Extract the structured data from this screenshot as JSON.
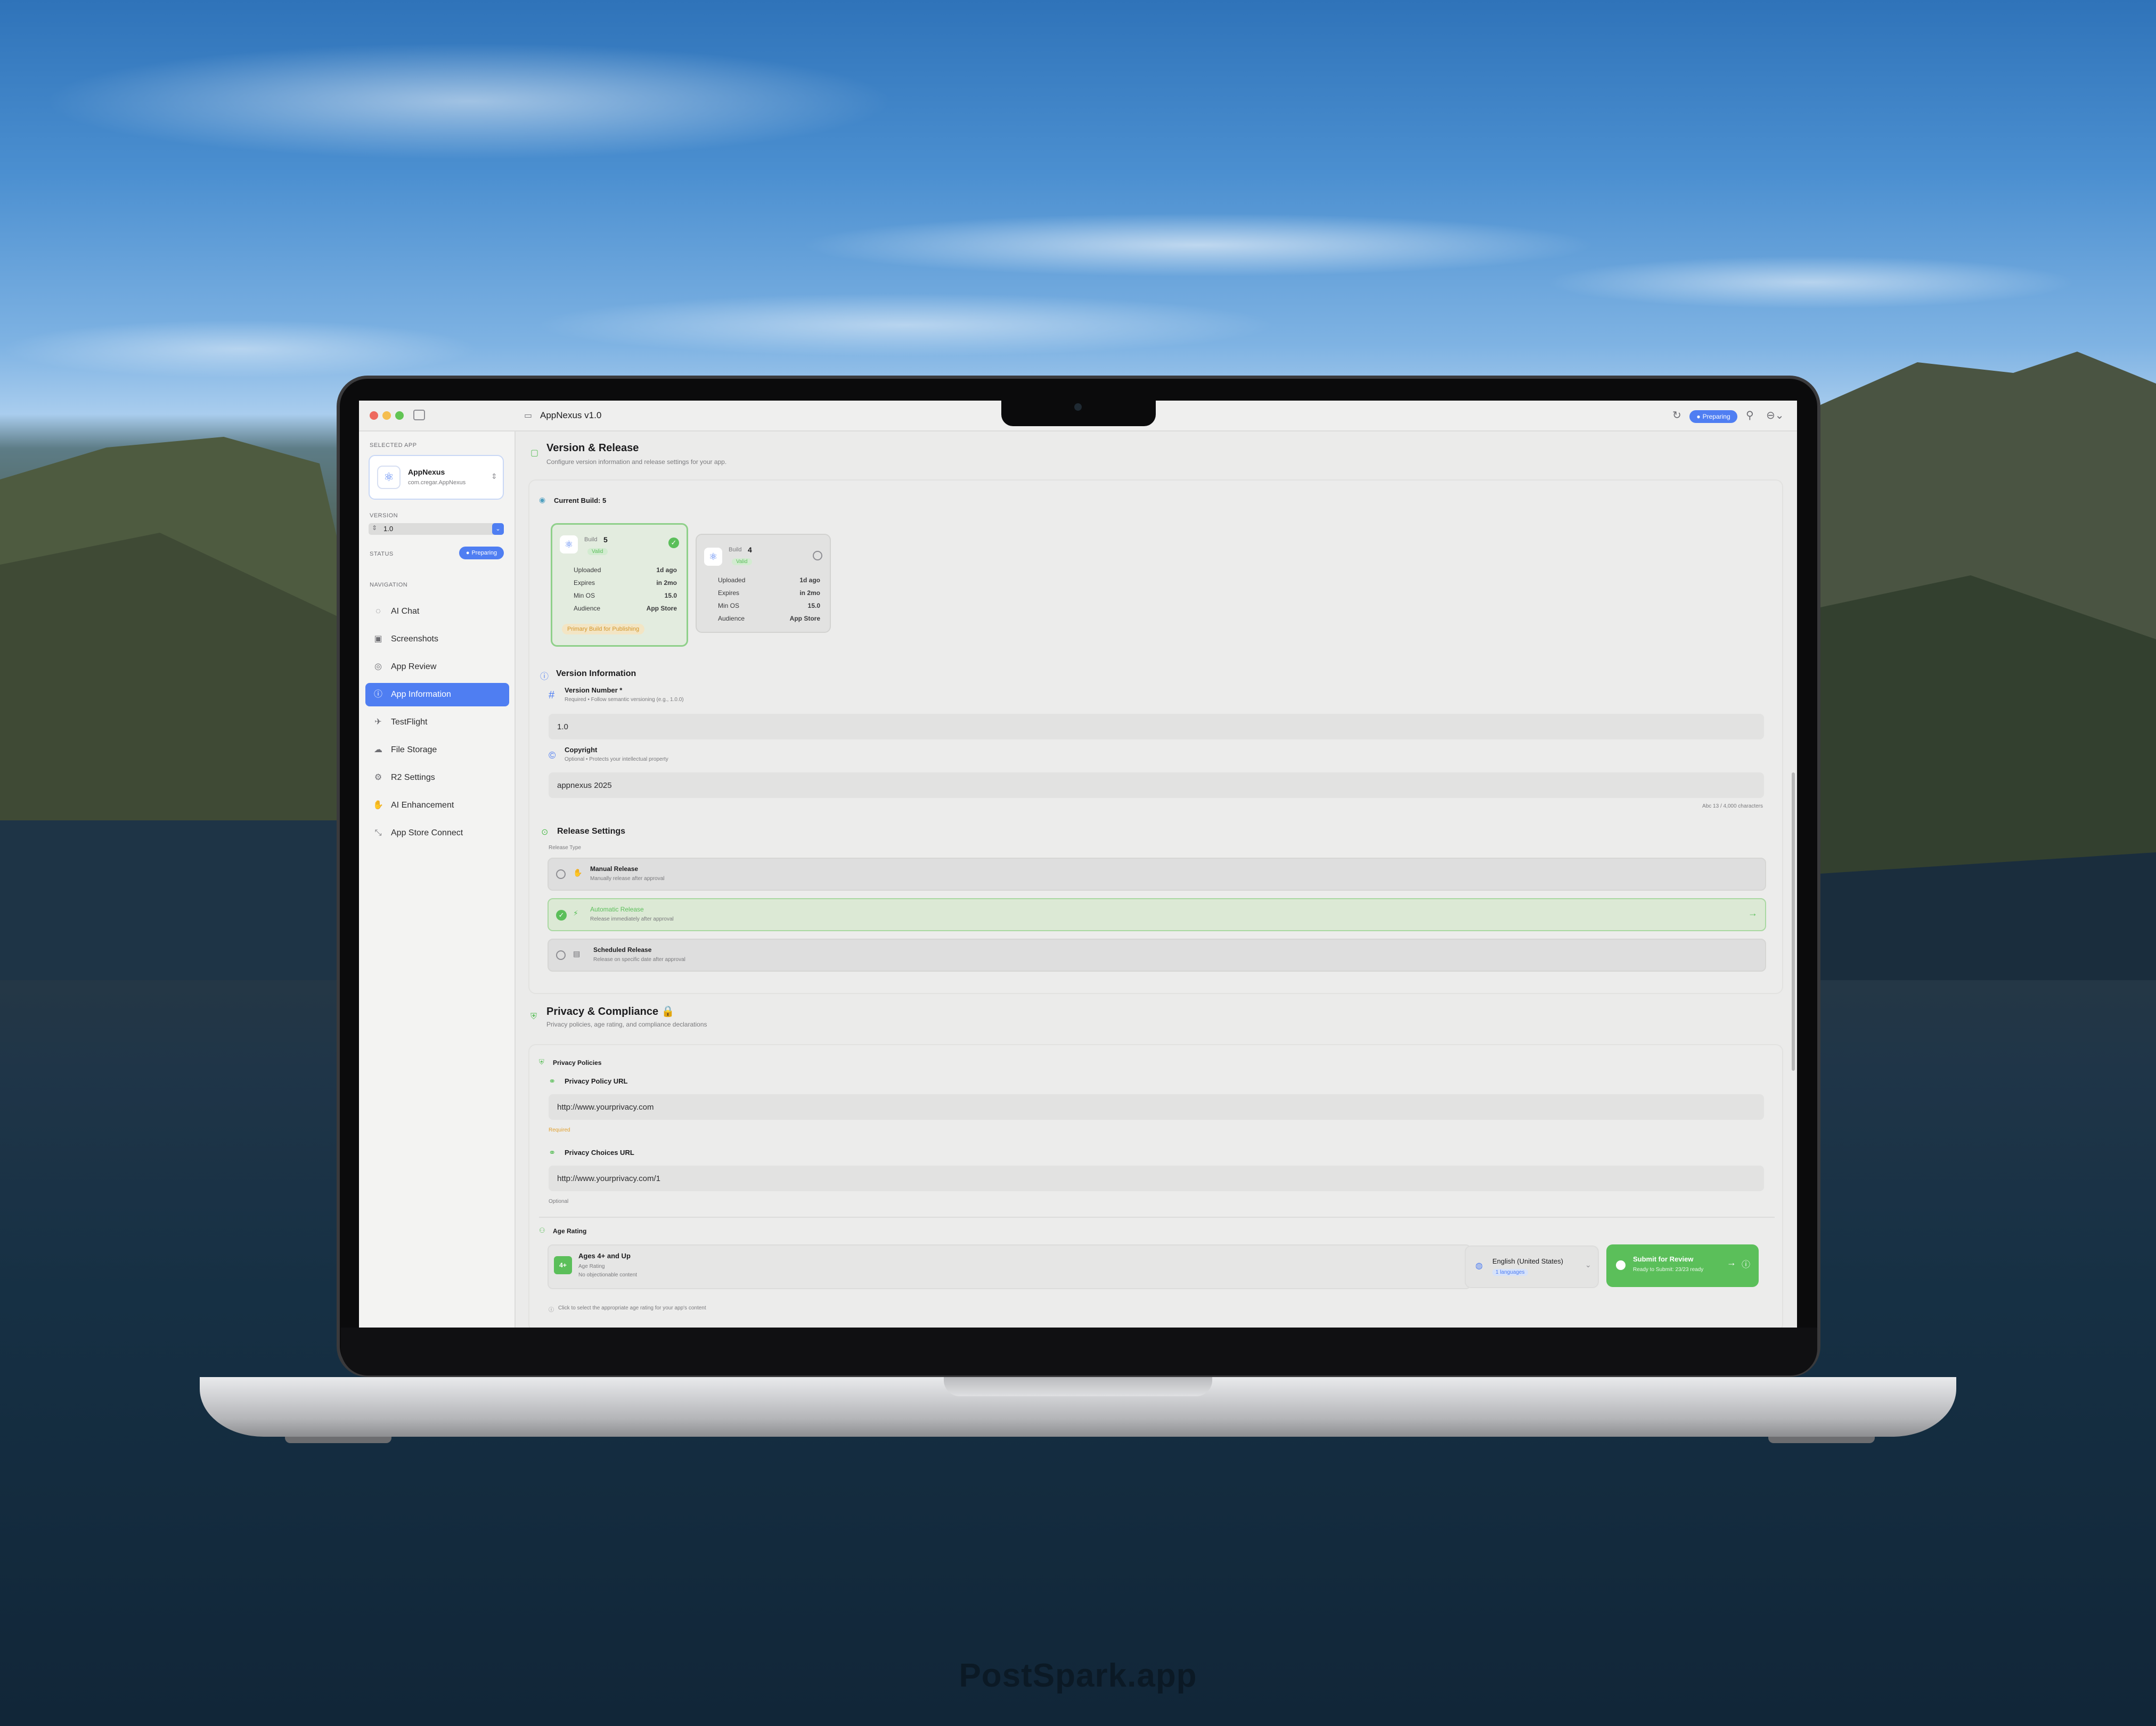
{
  "app": {
    "window_title": "AppNexus v1.0",
    "status_badge": "Preparing"
  },
  "sidebar": {
    "selected_app_label": "SELECTED APP",
    "app_name": "AppNexus",
    "bundle_id": "com.cregar.AppNexus",
    "version_label": "VERSION",
    "version_value": "1.0",
    "status_label": "STATUS",
    "status_value": "Preparing",
    "navigation_label": "NAVIGATION",
    "items": [
      {
        "label": "AI Chat",
        "icon": "chat-icon"
      },
      {
        "label": "Screenshots",
        "icon": "screenshots-icon"
      },
      {
        "label": "App Review",
        "icon": "review-icon"
      },
      {
        "label": "App Information",
        "icon": "info-icon",
        "active": true
      },
      {
        "label": "TestFlight",
        "icon": "testflight-icon"
      },
      {
        "label": "File Storage",
        "icon": "storage-icon"
      },
      {
        "label": "R2 Settings",
        "icon": "gear-icon"
      },
      {
        "label": "AI Enhancement",
        "icon": "enhancement-icon"
      },
      {
        "label": "App Store Connect",
        "icon": "connect-icon"
      }
    ]
  },
  "version_release": {
    "title": "Version & Release",
    "subtitle": "Configure version information and release settings for your app.",
    "current_build_label": "Current Build: 5",
    "builds": [
      {
        "build_label": "Build",
        "number": "5",
        "valid": "Valid",
        "uploaded_label": "Uploaded",
        "uploaded": "1d ago",
        "expires_label": "Expires",
        "expires": "in 2mo",
        "minos_label": "Min OS",
        "minos": "15.0",
        "audience_label": "Audience",
        "audience": "App Store",
        "primary": "Primary Build for Publishing"
      },
      {
        "build_label": "Build",
        "number": "4",
        "valid": "Valid",
        "uploaded_label": "Uploaded",
        "uploaded": "1d ago",
        "expires_label": "Expires",
        "expires": "in 2mo",
        "minos_label": "Min OS",
        "minos": "15.0",
        "audience_label": "Audience",
        "audience": "App Store"
      }
    ],
    "version_info_title": "Version Information",
    "version_number_label": "Version Number *",
    "version_number_hint": "Required • Follow semantic versioning (e.g., 1.0.0)",
    "version_number_value": "1.0",
    "copyright_label": "Copyright",
    "copyright_hint": "Optional • Protects your intellectual property",
    "copyright_value": "appnexus 2025",
    "char_count": "Abc 13 / 4,000 characters",
    "release_settings_title": "Release Settings",
    "release_type_label": "Release Type",
    "release_options": [
      {
        "title": "Manual Release",
        "desc": "Manually release after approval"
      },
      {
        "title": "Automatic Release",
        "desc": "Release immediately after approval"
      },
      {
        "title": "Scheduled Release",
        "desc": "Release on specific date after approval"
      }
    ]
  },
  "privacy": {
    "title": "Privacy & Compliance 🔒",
    "subtitle": "Privacy policies, age rating, and compliance declarations",
    "policies_label": "Privacy Policies",
    "policy_url_label": "Privacy Policy URL",
    "policy_url_value": "http://www.yourprivacy.com",
    "policy_required": "Required",
    "choices_url_label": "Privacy Choices URL",
    "choices_url_value": "http://www.yourprivacy.com/1",
    "choices_optional": "Optional",
    "age_rating_label": "Age Rating",
    "age_badge": "4+",
    "age_title": "Ages 4+ and Up",
    "age_sub1": "Age Rating",
    "age_sub2": "No objectionable content",
    "age_hint": "Click to select the appropriate age rating for your app's content"
  },
  "footer": {
    "language": "English (United States)",
    "languages_count": "1 languages",
    "submit_title": "Submit for Review",
    "submit_sub": "Ready to Submit: 23/23 ready"
  },
  "watermark": "PostSpark.app",
  "colors": {
    "accent": "#4f7ef2",
    "success": "#5bbf5a",
    "warning": "#e0a030"
  }
}
